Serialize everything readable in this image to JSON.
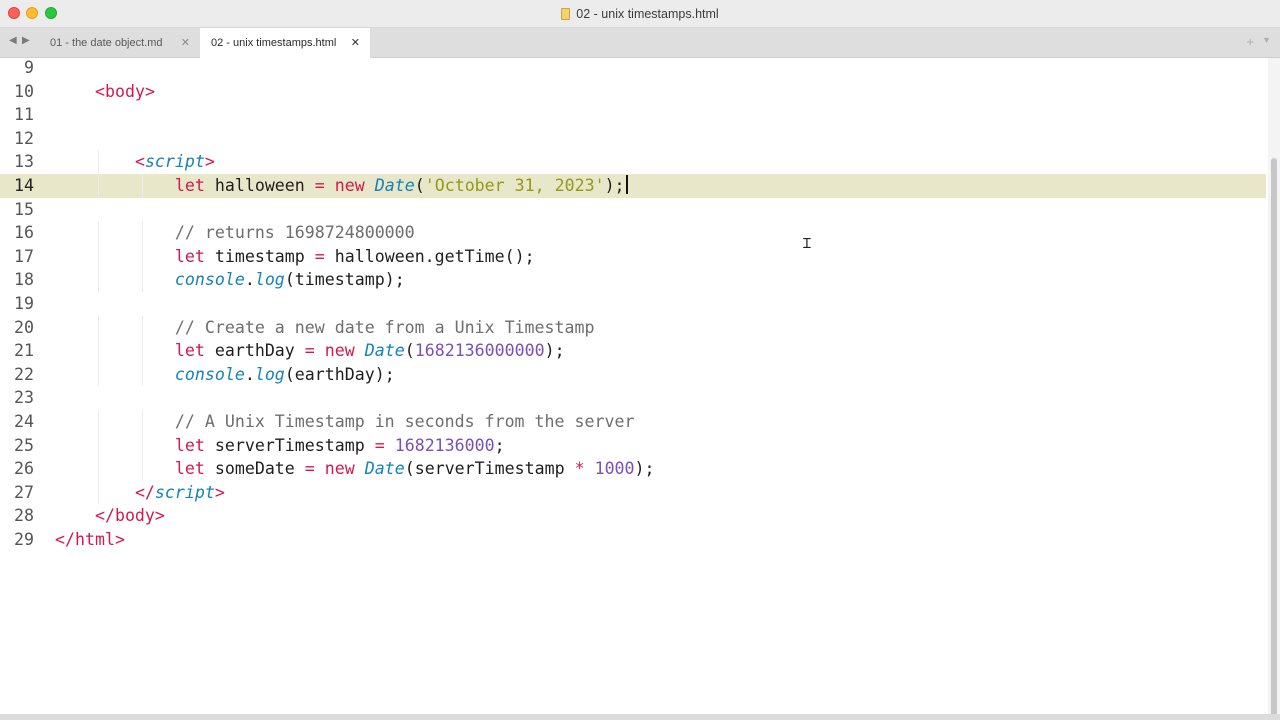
{
  "window": {
    "title": "02 - unix timestamps.html",
    "nav_back_icon": "◀",
    "nav_forward_icon": "▶"
  },
  "tabs": [
    {
      "label": "01 - the date object.md",
      "close": "✕",
      "active": false
    },
    {
      "label": "02 - unix timestamps.html",
      "close": "✕",
      "active": true
    }
  ],
  "tab_actions": {
    "new_tab": "+",
    "menu": "▼"
  },
  "colors": {
    "keyword": "#d3194c",
    "class": "#1483b8",
    "string": "#939a18",
    "number": "#7b4fb8",
    "comment": "#6e6e6e",
    "active_line": "#e8e7c9"
  },
  "editor": {
    "active_line": 14,
    "lines": [
      {
        "n": "9",
        "segments": []
      },
      {
        "n": "10",
        "segments": [
          {
            "t": "    "
          },
          {
            "t": "<",
            "c": "tag"
          },
          {
            "t": "body",
            "c": "tag"
          },
          {
            "t": ">",
            "c": "tag"
          }
        ]
      },
      {
        "n": "11",
        "segments": []
      },
      {
        "n": "12",
        "segments": []
      },
      {
        "n": "13",
        "segments": [
          {
            "t": "        "
          },
          {
            "t": "<",
            "c": "tag"
          },
          {
            "t": "script",
            "c": "cls"
          },
          {
            "t": ">",
            "c": "tag"
          }
        ]
      },
      {
        "n": "14",
        "segments": [
          {
            "t": "            "
          },
          {
            "t": "let",
            "c": "kw"
          },
          {
            "t": " halloween "
          },
          {
            "t": "=",
            "c": "op"
          },
          {
            "t": " "
          },
          {
            "t": "new",
            "c": "kw"
          },
          {
            "t": " "
          },
          {
            "t": "Date",
            "c": "cls"
          },
          {
            "t": "("
          },
          {
            "t": "'October 31, 2023'",
            "c": "str"
          },
          {
            "t": ");"
          }
        ]
      },
      {
        "n": "15",
        "segments": []
      },
      {
        "n": "16",
        "segments": [
          {
            "t": "            "
          },
          {
            "t": "// returns 1698724800000",
            "c": "cmt"
          }
        ]
      },
      {
        "n": "17",
        "segments": [
          {
            "t": "            "
          },
          {
            "t": "let",
            "c": "kw"
          },
          {
            "t": " timestamp "
          },
          {
            "t": "=",
            "c": "op"
          },
          {
            "t": " halloween.getTime();"
          }
        ]
      },
      {
        "n": "18",
        "segments": [
          {
            "t": "            "
          },
          {
            "t": "console",
            "c": "cls"
          },
          {
            "t": "."
          },
          {
            "t": "log",
            "c": "cls"
          },
          {
            "t": "(timestamp);"
          }
        ]
      },
      {
        "n": "19",
        "segments": []
      },
      {
        "n": "20",
        "segments": [
          {
            "t": "            "
          },
          {
            "t": "// Create a new date from a Unix Timestamp",
            "c": "cmt"
          }
        ]
      },
      {
        "n": "21",
        "segments": [
          {
            "t": "            "
          },
          {
            "t": "let",
            "c": "kw"
          },
          {
            "t": " earthDay "
          },
          {
            "t": "=",
            "c": "op"
          },
          {
            "t": " "
          },
          {
            "t": "new",
            "c": "kw"
          },
          {
            "t": " "
          },
          {
            "t": "Date",
            "c": "cls"
          },
          {
            "t": "("
          },
          {
            "t": "1682136000000",
            "c": "num"
          },
          {
            "t": ");"
          }
        ]
      },
      {
        "n": "22",
        "segments": [
          {
            "t": "            "
          },
          {
            "t": "console",
            "c": "cls"
          },
          {
            "t": "."
          },
          {
            "t": "log",
            "c": "cls"
          },
          {
            "t": "(earthDay);"
          }
        ]
      },
      {
        "n": "23",
        "segments": []
      },
      {
        "n": "24",
        "segments": [
          {
            "t": "            "
          },
          {
            "t": "// A Unix Timestamp in seconds from the server",
            "c": "cmt"
          }
        ]
      },
      {
        "n": "25",
        "segments": [
          {
            "t": "            "
          },
          {
            "t": "let",
            "c": "kw"
          },
          {
            "t": " serverTimestamp "
          },
          {
            "t": "=",
            "c": "op"
          },
          {
            "t": " "
          },
          {
            "t": "1682136000",
            "c": "num"
          },
          {
            "t": ";"
          }
        ]
      },
      {
        "n": "26",
        "segments": [
          {
            "t": "            "
          },
          {
            "t": "let",
            "c": "kw"
          },
          {
            "t": " someDate "
          },
          {
            "t": "=",
            "c": "op"
          },
          {
            "t": " "
          },
          {
            "t": "new",
            "c": "kw"
          },
          {
            "t": " "
          },
          {
            "t": "Date",
            "c": "cls"
          },
          {
            "t": "(serverTimestamp "
          },
          {
            "t": "*",
            "c": "op"
          },
          {
            "t": " "
          },
          {
            "t": "1000",
            "c": "num"
          },
          {
            "t": ");"
          }
        ]
      },
      {
        "n": "27",
        "segments": [
          {
            "t": "        "
          },
          {
            "t": "</",
            "c": "tag"
          },
          {
            "t": "script",
            "c": "cls"
          },
          {
            "t": ">",
            "c": "tag"
          }
        ]
      },
      {
        "n": "28",
        "segments": [
          {
            "t": "    "
          },
          {
            "t": "</",
            "c": "tag"
          },
          {
            "t": "body",
            "c": "tag"
          },
          {
            "t": ">",
            "c": "tag"
          }
        ]
      },
      {
        "n": "29",
        "segments": [
          {
            "t": "</",
            "c": "tag"
          },
          {
            "t": "html",
            "c": "tag"
          },
          {
            "t": ">",
            "c": "tag"
          }
        ]
      }
    ]
  },
  "cursor_icon": "text-cursor-icon"
}
